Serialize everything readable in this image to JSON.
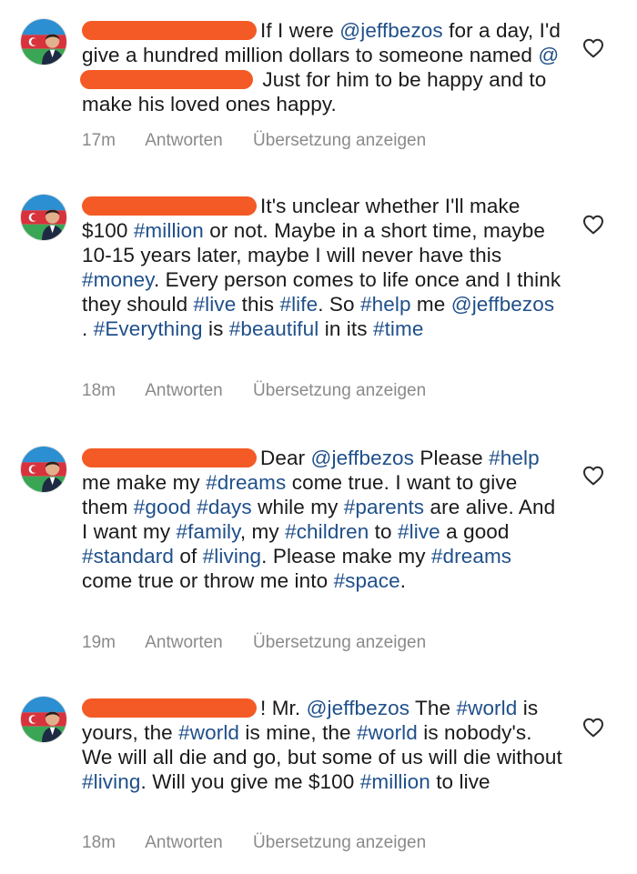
{
  "comments": [
    {
      "parts": [
        {
          "t": "text",
          "v": "If I were "
        },
        {
          "t": "mention",
          "v": "@jeffbezos"
        },
        {
          "t": "text",
          "v": " for a day, I'd give a hundred million dollars to someone named "
        },
        {
          "t": "mention",
          "v": "@"
        },
        {
          "t": "redact",
          "w": 190
        },
        {
          "t": "text",
          "v": " Just for him to be happy and to make his loved ones happy."
        }
      ],
      "time": "17m",
      "reply": "Antworten",
      "translate": "Übersetzung anzeigen"
    },
    {
      "parts": [
        {
          "t": "text",
          "v": "It's unclear whether I'll make $100 "
        },
        {
          "t": "tag",
          "v": "#million"
        },
        {
          "t": "text",
          "v": " or not.  Maybe in a short time, maybe 10-15 years later, maybe I will never have this "
        },
        {
          "t": "tag",
          "v": "#money"
        },
        {
          "t": "text",
          "v": ".  Every person comes to life once and I think they should "
        },
        {
          "t": "tag",
          "v": "#live"
        },
        {
          "t": "text",
          "v": " this "
        },
        {
          "t": "tag",
          "v": "#life"
        },
        {
          "t": "text",
          "v": ".  So "
        },
        {
          "t": "tag",
          "v": "#help"
        },
        {
          "t": "text",
          "v": " me "
        },
        {
          "t": "mention",
          "v": "@jeffbezos"
        },
        {
          "t": "text",
          "v": " .  "
        },
        {
          "t": "tag",
          "v": "#Everything"
        },
        {
          "t": "text",
          "v": " is "
        },
        {
          "t": "tag",
          "v": "#beautiful"
        },
        {
          "t": "text",
          "v": " in its "
        },
        {
          "t": "tag",
          "v": "#time"
        }
      ],
      "time": "18m",
      "reply": "Antworten",
      "translate": "Übersetzung anzeigen"
    },
    {
      "parts": [
        {
          "t": "text",
          "v": "Dear "
        },
        {
          "t": "mention",
          "v": "@jeffbezos"
        },
        {
          "t": "text",
          "v": " Please "
        },
        {
          "t": "tag",
          "v": "#help"
        },
        {
          "t": "text",
          "v": " me make my "
        },
        {
          "t": "tag",
          "v": "#dreams"
        },
        {
          "t": "text",
          "v": " come true.  I want to give them "
        },
        {
          "t": "tag",
          "v": "#good"
        },
        {
          "t": "text",
          "v": " "
        },
        {
          "t": "tag",
          "v": "#days"
        },
        {
          "t": "text",
          "v": " while my "
        },
        {
          "t": "tag",
          "v": "#parents"
        },
        {
          "t": "text",
          "v": " are alive.  And I want my "
        },
        {
          "t": "tag",
          "v": "#family"
        },
        {
          "t": "text",
          "v": ", my "
        },
        {
          "t": "tag",
          "v": "#children"
        },
        {
          "t": "text",
          "v": " to "
        },
        {
          "t": "tag",
          "v": "#live"
        },
        {
          "t": "text",
          "v": " a good "
        },
        {
          "t": "tag",
          "v": "#standard"
        },
        {
          "t": "text",
          "v": " of "
        },
        {
          "t": "tag",
          "v": "#living"
        },
        {
          "t": "text",
          "v": ".  Please make my "
        },
        {
          "t": "tag",
          "v": "#dreams"
        },
        {
          "t": "text",
          "v": " come true or throw me into "
        },
        {
          "t": "tag",
          "v": "#space"
        },
        {
          "t": "text",
          "v": "."
        }
      ],
      "time": "19m",
      "reply": "Antworten",
      "translate": "Übersetzung anzeigen"
    },
    {
      "parts": [
        {
          "t": "text",
          "v": "! Mr. "
        },
        {
          "t": "mention",
          "v": "@jeffbezos"
        },
        {
          "t": "text",
          "v": " The "
        },
        {
          "t": "tag",
          "v": "#world"
        },
        {
          "t": "text",
          "v": " is yours, the "
        },
        {
          "t": "tag",
          "v": "#world"
        },
        {
          "t": "text",
          "v": " is mine, the "
        },
        {
          "t": "tag",
          "v": "#world"
        },
        {
          "t": "text",
          "v": " is nobody's.  We will all die and go, but some of us will die without "
        },
        {
          "t": "tag",
          "v": "#living"
        },
        {
          "t": "text",
          "v": ".  Will you give me $100 "
        },
        {
          "t": "tag",
          "v": "#million"
        },
        {
          "t": "text",
          "v": " to live"
        }
      ],
      "time": "18m",
      "reply": "Antworten",
      "translate": "Übersetzung anzeigen"
    }
  ],
  "colors": {
    "link": "#1f4f8a",
    "redaction": "#f45a25",
    "meta": "#8a8a8a"
  },
  "icons": {
    "like": "heart-outline-icon",
    "avatar": "profile-avatar"
  }
}
